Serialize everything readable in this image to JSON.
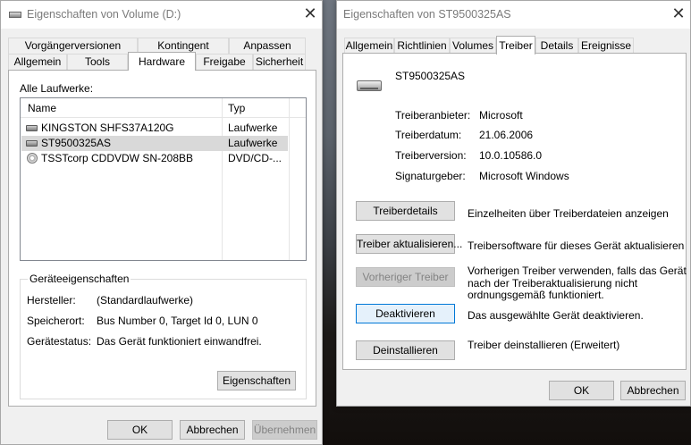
{
  "left_window": {
    "title": "Eigenschaften von Volume (D:)",
    "close_glyph": "✕",
    "tabs_row1": [
      "Vorgängerversionen",
      "Kontingent",
      "Anpassen"
    ],
    "tabs_row2": [
      "Allgemein",
      "Tools",
      "Hardware",
      "Freigabe",
      "Sicherheit"
    ],
    "active_tab": "Hardware",
    "all_drives_label": "Alle Laufwerke:",
    "columns": [
      "Name",
      "Typ"
    ],
    "drives": [
      {
        "name": "KINGSTON SHFS37A120G",
        "type": "Laufwerke",
        "icon": "hard-drive-icon"
      },
      {
        "name": "ST9500325AS",
        "type": "Laufwerke",
        "icon": "hard-drive-icon",
        "selected": true
      },
      {
        "name": "TSSTcorp CDDVDW SN-208BB",
        "type": "DVD/CD-...",
        "icon": "cd-drive-icon"
      }
    ],
    "device_props_title": "Geräteeigenschaften",
    "props": [
      {
        "label": "Hersteller:",
        "value": "(Standardlaufwerke)"
      },
      {
        "label": "Speicherort:",
        "value": "Bus Number 0, Target Id 0, LUN 0"
      },
      {
        "label": "Gerätestatus:",
        "value": "Das Gerät funktioniert einwandfrei."
      }
    ],
    "properties_button": "Eigenschaften",
    "ok": "OK",
    "cancel": "Abbrechen",
    "apply": "Übernehmen"
  },
  "right_window": {
    "title": "Eigenschaften von ST9500325AS",
    "close_glyph": "✕",
    "tabs": [
      "Allgemein",
      "Richtlinien",
      "Volumes",
      "Treiber",
      "Details",
      "Ereignisse"
    ],
    "active_tab": "Treiber",
    "device_name": "ST9500325AS",
    "info": [
      {
        "label": "Treiberanbieter:",
        "value": "Microsoft"
      },
      {
        "label": "Treiberdatum:",
        "value": "21.06.2006"
      },
      {
        "label": "Treiberversion:",
        "value": "10.0.10586.0"
      },
      {
        "label": "Signaturgeber:",
        "value": "Microsoft Windows"
      }
    ],
    "actions": [
      {
        "button": "Treiberdetails",
        "desc": "Einzelheiten über Treiberdateien anzeigen"
      },
      {
        "button": "Treiber aktualisieren...",
        "desc": "Treibersoftware für dieses Gerät aktualisieren"
      },
      {
        "button": "Vorheriger Treiber",
        "desc_lines": [
          "Vorherigen Treiber verwenden, falls das Gerät",
          "nach der Treiberaktualisierung nicht",
          "ordnungsgemäß funktioniert."
        ],
        "disabled": true
      },
      {
        "button": "Deaktivieren",
        "desc": "Das ausgewählte Gerät deaktivieren."
      },
      {
        "button": "Deinstallieren",
        "desc": "Treiber deinstallieren (Erweitert)"
      }
    ],
    "ok": "OK",
    "cancel": "Abbrechen"
  },
  "colors": {
    "window_bg": "#f0f0f0",
    "focus_blue": "#0078d7",
    "selection_gray": "#d9d9d9"
  }
}
